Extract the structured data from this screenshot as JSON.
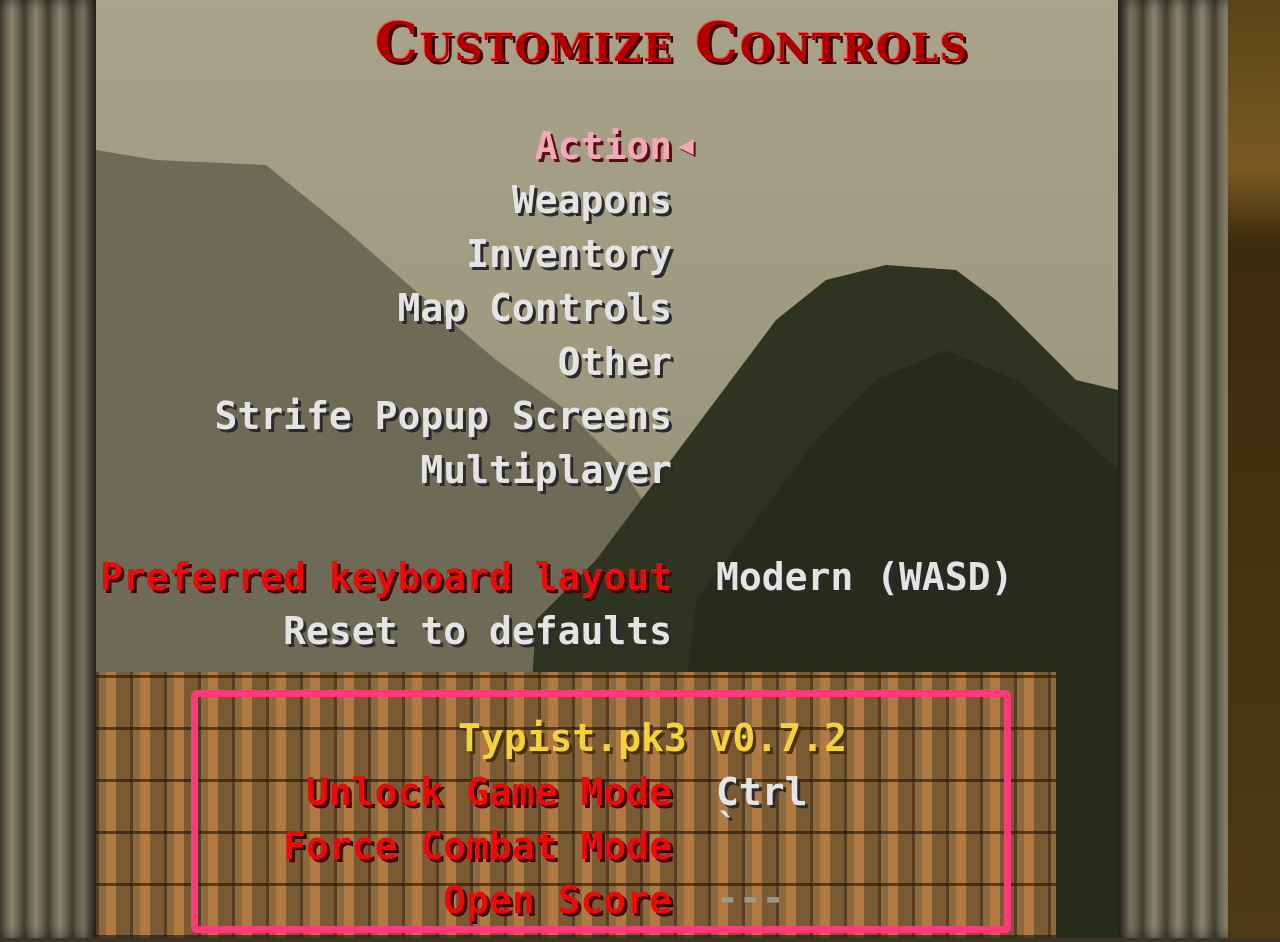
{
  "menu": {
    "title": "Customize Controls",
    "selector_icon": "left-triangle-icon",
    "categories": [
      {
        "label": "Action",
        "selected": true
      },
      {
        "label": "Weapons",
        "selected": false
      },
      {
        "label": "Inventory",
        "selected": false
      },
      {
        "label": "Map Controls",
        "selected": false
      },
      {
        "label": "Other",
        "selected": false
      },
      {
        "label": "Strife Popup Screens",
        "selected": false
      },
      {
        "label": "Multiplayer",
        "selected": false
      }
    ],
    "keyboard_layout": {
      "label": "Preferred keyboard layout",
      "value": "Modern (WASD)"
    },
    "reset": {
      "label": "Reset to defaults"
    }
  },
  "mod": {
    "title": "Typist.pk3 v0.7.2",
    "bindings": [
      {
        "label": "Unlock Game Mode",
        "value": "Ctrl"
      },
      {
        "label": "Force Combat Mode",
        "value": "`"
      },
      {
        "label": "Open Score",
        "value": "---"
      }
    ]
  },
  "colors": {
    "title_red": "#b00000",
    "selected_pink": "#f3a8b6",
    "option_red": "#ea0a0a",
    "mod_title_yellow": "#f4d23a",
    "highlight_box": "#ff3a78"
  }
}
